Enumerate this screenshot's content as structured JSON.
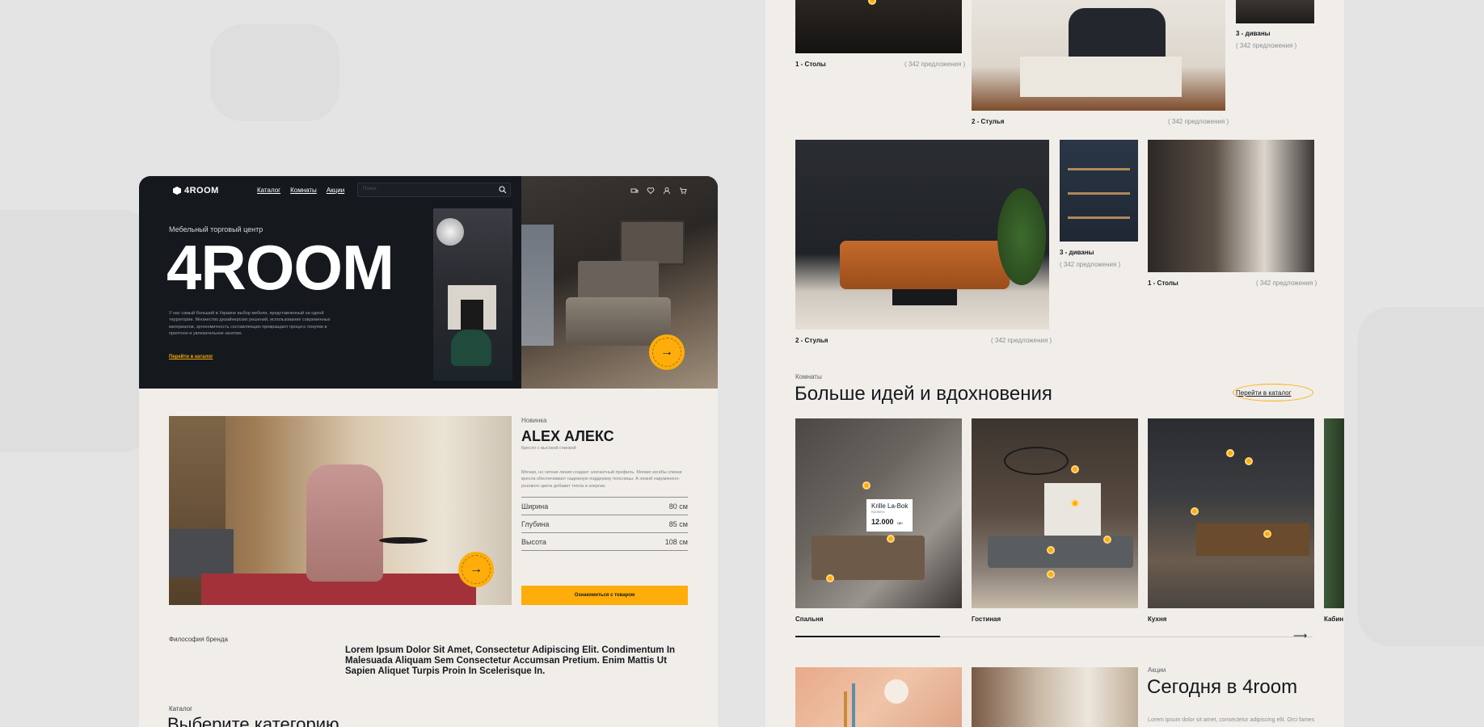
{
  "brand": {
    "name": "4ROOM"
  },
  "nav": {
    "items": [
      "Каталог",
      "Комнаты",
      "Акции"
    ]
  },
  "search": {
    "placeholder": "Поиск"
  },
  "hero": {
    "subtitle": "Мебельный торговый центр",
    "title": "4ROOM",
    "description": "У нас самый большой в Украине выбор мебели, представленный на одной территории. Множество дизайнерских решений, использование современных материалов, эргономичность составляющих превращают процесс покупки в приятное и увлекательное занятие.",
    "link": "Перейти в каталог",
    "badge": "ПЕРЕЙТИ В КАТАЛОГ"
  },
  "product": {
    "tag": "Новинка",
    "name": "ALEX АЛЕКС",
    "subtitle": "Кресло с высокой спинкой",
    "description": "Мягкая, но четкая линия создает элегантный профиль. Мягкие изгибы спинки кресла обеспечивают надежную поддержку поясницы. А нежнй нарумянено-розового цвета добавит тепла и энергии.",
    "specs": [
      {
        "label": "Ширина",
        "value": "80 см"
      },
      {
        "label": "Глубина",
        "value": "85 см"
      },
      {
        "label": "Высота",
        "value": "108 см"
      }
    ],
    "button": "Ознакомиться с товаром",
    "badge": "ПЕРЕЙТИ В КАТАЛОГ"
  },
  "philosophy": {
    "label": "Философия бренда",
    "text": "Lorem Ipsum Dolor Sit Amet, Consectetur Adipiscing Elit. Condimentum In Malesuada Aliquam Sem Consectetur Accumsan Pretium. Enim Mattis Ut Sapien Aliquet Turpis Proin In Scelerisque In."
  },
  "catalog": {
    "label": "Каталог",
    "title": "Выберите категорию"
  },
  "categories": [
    {
      "name": "1 - Столы",
      "count": "( 342 предложения )"
    },
    {
      "name": "2 - Стулья",
      "count": "( 342 предложения )"
    },
    {
      "name": "3 - диваны",
      "count": "( 342 предложения )"
    },
    {
      "name": "2 - Стулья",
      "count": "( 342 предложения )"
    },
    {
      "name": "3 - диваны",
      "count": "( 342 предложения )"
    },
    {
      "name": "1 - Столы",
      "count": "( 342 предложения )"
    }
  ],
  "rooms": {
    "label": "Комнаты",
    "title": "Больше идей и вдохновения",
    "link": "Перейти в каталог",
    "items": [
      "Спальня",
      "Гостиная",
      "Кухня",
      "Кабин"
    ],
    "progress": 0.28,
    "tooltip": {
      "name": "Krille La-Bok",
      "sub": "Кровать",
      "price": "12.000",
      "currency": "грн"
    }
  },
  "sales": {
    "label": "Акции",
    "title": "Сегодня в 4room",
    "text": "Lorem ipsum dolor sit amet, consectetur adipiscing elit. Orci fames"
  }
}
